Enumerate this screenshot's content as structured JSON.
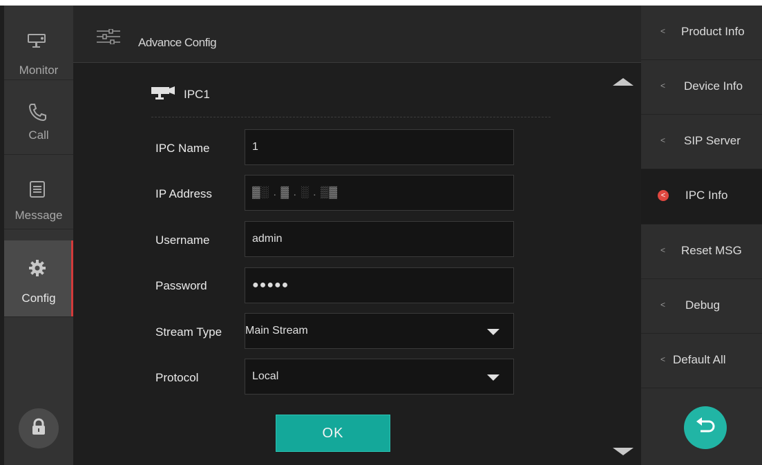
{
  "left_nav": {
    "items": [
      {
        "label": "Monitor",
        "icon": "camera-icon"
      },
      {
        "label": "Call",
        "icon": "phone-icon"
      },
      {
        "label": "Message",
        "icon": "message-icon"
      },
      {
        "label": "Config",
        "icon": "gear-icon"
      }
    ],
    "active": "Config",
    "lock_icon": "lock-icon"
  },
  "header": {
    "title": "Advance Config",
    "icon": "sliders-icon"
  },
  "form": {
    "section_title": "IPC1",
    "fields": [
      {
        "label": "IPC Name",
        "value": "1"
      },
      {
        "label": "IP Address",
        "value": "▓░ . ▓ . ░ . ▒▓"
      },
      {
        "label": "Username",
        "value": "admin"
      },
      {
        "label": "Password",
        "value": "●●●●●"
      },
      {
        "label": "Stream Type",
        "value": "Main Stream"
      },
      {
        "label": "Protocol",
        "value": "Local"
      }
    ],
    "ok_label": "OK"
  },
  "right_nav": {
    "items": [
      {
        "label": "Product Info"
      },
      {
        "label": "Device Info"
      },
      {
        "label": "SIP Server"
      },
      {
        "label": "IPC Info"
      },
      {
        "label": "Reset MSG"
      },
      {
        "label": "Debug"
      },
      {
        "label": "Default All"
      }
    ],
    "active": "IPC Info",
    "back_icon": "back-arrow-icon"
  },
  "colors": {
    "accent": "#14a89a",
    "active_marker": "#d23a3a",
    "background": "#1e1e1e"
  }
}
